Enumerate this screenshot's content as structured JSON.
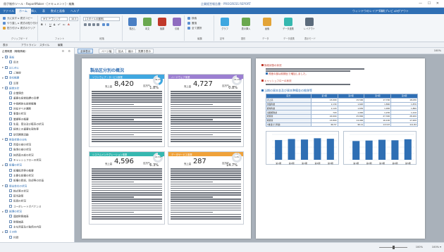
{
  "window": {
    "title": "冊子制作ツール - ReportMaker - [ドキュメント] - 編集",
    "center_title": "企業経営報告書 - PROGRESS REPORT",
    "controls": "— ☐ ✕"
  },
  "menu": {
    "tabs": [
      "ファイル",
      "ホーム",
      "挿入",
      "表",
      "数式と画像",
      "ヘルプ"
    ],
    "active_index": 1,
    "right": [
      "ウィンドウのレイアウト",
      "印刷プレビュー",
      "ログアウト"
    ]
  },
  "ribbon": {
    "clipboard": {
      "label": "クリップボード",
      "lines": [
        "元に戻す  ▸ 書式コピー",
        "やり直し  ▸ 書式の貼り付け",
        "貼り付け ▸ 書式のクリア"
      ]
    },
    "font": {
      "label": "フォント",
      "font_name": "ＭＳ Ｐゴシック",
      "font_size": "10.5",
      "styles": [
        "B",
        "I",
        "U",
        "S",
        "x²",
        "x₂",
        "A"
      ]
    },
    "paragraph": {
      "label": "段落",
      "style_value": "[スタイルの選択]"
    },
    "style_buttons": [
      {
        "label": "見出し"
      },
      {
        "label": "本文"
      },
      {
        "label": "強調"
      },
      {
        "label": "引用"
      }
    ],
    "edit": {
      "label": "編集",
      "lines": [
        "検索",
        "置換",
        "全て選択"
      ]
    },
    "insert_buttons": [
      {
        "label": "グラフ"
      },
      {
        "label": "表の挿入"
      },
      {
        "label": "画像"
      },
      {
        "label": "データ連携"
      },
      {
        "label": "レイアウト"
      }
    ],
    "group_labels": [
      "記号",
      "図形",
      "データ",
      "データ連携",
      "表示モード"
    ]
  },
  "subbar": {
    "tabs": [
      "表示",
      "アウトライン",
      "スタイル",
      "編集"
    ]
  },
  "sidebar": {
    "header": "企業概要（概略情報）",
    "icons": "☰ ⚙",
    "items": [
      {
        "label": "表紙",
        "group": true,
        "indent": 0
      },
      {
        "label": "目次",
        "group": false,
        "indent": 1
      },
      {
        "label": "はじめに",
        "group": true,
        "indent": 0
      },
      {
        "label": "ご挨拶",
        "group": false,
        "indent": 1
      },
      {
        "label": "会社概要",
        "group": true,
        "indent": 0
      },
      {
        "label": "沿革",
        "group": false,
        "indent": 1
      },
      {
        "label": "経営方針",
        "group": true,
        "indent": 0
      },
      {
        "label": "企業理念",
        "group": false,
        "indent": 1
      },
      {
        "label": "重要な経営指標の目標",
        "group": false,
        "indent": 1
      },
      {
        "label": "中長期的な経営戦略",
        "group": false,
        "indent": 1
      },
      {
        "label": "対処すべき課題",
        "group": false,
        "indent": 1
      },
      {
        "label": "事業の状況",
        "group": false,
        "indent": 1
      },
      {
        "label": "業績等の概要",
        "group": false,
        "indent": 1
      },
      {
        "label": "生産、受注及び販売の状況",
        "group": false,
        "indent": 1
      },
      {
        "label": "経営上の重要な契約等",
        "group": false,
        "indent": 1
      },
      {
        "label": "研究開発活動",
        "group": false,
        "indent": 1
      },
      {
        "label": "財政状態の分析",
        "group": true,
        "indent": 0
      },
      {
        "label": "資産の部の状況",
        "group": false,
        "indent": 1
      },
      {
        "label": "負債の部の状況",
        "group": false,
        "indent": 1
      },
      {
        "label": "純資産の部の状況",
        "group": false,
        "indent": 1
      },
      {
        "label": "キャッシュフローの状況",
        "group": false,
        "indent": 1
      },
      {
        "label": "設備の状況",
        "group": true,
        "indent": 0
      },
      {
        "label": "設備投資等の概要",
        "group": false,
        "indent": 1
      },
      {
        "label": "主要な設備の状況",
        "group": false,
        "indent": 1
      },
      {
        "label": "設備の新設、除却等の計画",
        "group": false,
        "indent": 1
      },
      {
        "label": "提出会社の状況",
        "group": true,
        "indent": 0
      },
      {
        "label": "株式等の状況",
        "group": false,
        "indent": 1
      },
      {
        "label": "配当政策",
        "group": false,
        "indent": 1
      },
      {
        "label": "役員の状況",
        "group": false,
        "indent": 1
      },
      {
        "label": "コーポレートガバナンス",
        "group": false,
        "indent": 1
      },
      {
        "label": "経理の状況",
        "group": true,
        "indent": 0
      },
      {
        "label": "連結財務諸表",
        "group": false,
        "indent": 1
      },
      {
        "label": "財務諸表",
        "group": false,
        "indent": 1
      },
      {
        "label": "主な資産及び負債の内容",
        "group": false,
        "indent": 1
      },
      {
        "label": "その他",
        "group": true,
        "indent": 0
      },
      {
        "label": "付録",
        "group": false,
        "indent": 1
      }
    ]
  },
  "toolbar": {
    "buttons": [
      "全体表示",
      "ページ幅",
      "拡大",
      "縮小",
      "見開き表示"
    ],
    "active_index": 0,
    "right": "100%"
  },
  "page_left": {
    "title": "製品区分別の概況",
    "cards": [
      {
        "band": "ソフトウェア・サービス事業",
        "color": "#3fa7e0",
        "pct": "46.2%",
        "label": "売上高",
        "value": "8,420",
        "unit": "百万円",
        "sub": "1.8%"
      },
      {
        "band": "ハードウェア事業",
        "color": "#9b7fd1",
        "pct": "23.1%",
        "label": "売上高",
        "value": "4,727",
        "unit": "百万円",
        "sub": "0.8%"
      },
      {
        "band": "システムインテグレーション事業",
        "color": "#36b8b0",
        "pct": "22.5%",
        "label": "売上高",
        "value": "4,596",
        "unit": "百万円",
        "sub": "6.3%"
      },
      {
        "band": "データサービス事業",
        "color": "#f0a23a",
        "pct": "1.4%",
        "label": "売上高",
        "value": "287",
        "unit": "百万円",
        "sub": "14.7%"
      }
    ],
    "card_pct_colors": [
      "#3fa7e0",
      "#9b7fd1",
      "#36b8b0",
      "#f0a23a"
    ]
  },
  "page_right": {
    "heads": [
      "財政状態の状況",
      "資産の部は前期比で増加しました。",
      "キャッシュフローの状況",
      "当期の資本金及び資本準備金の推移等"
    ],
    "table": {
      "headers": [
        "区分",
        "第1期",
        "第2期",
        "第3期",
        "第4期"
      ],
      "rows": [
        [
          "売上高",
          "13,000",
          "15,500",
          "17,700",
          "18,030"
        ],
        [
          "営業利益",
          "1,130",
          "1,620",
          "1,890",
          "1,870"
        ],
        [
          "経常利益",
          "1,120",
          "1,630",
          "1,900",
          "1,860"
        ],
        [
          "当期純利益",
          "720",
          "1,040",
          "1,230",
          "1,210"
        ],
        [
          "総資産",
          "24,600",
          "25,800",
          "27,300",
          "28,200"
        ],
        [
          "純資産",
          "13,800",
          "14,900",
          "16,100",
          "17,200"
        ],
        [
          "1株当たり利益",
          "66.57",
          "96.11",
          "113.67",
          "111.84"
        ]
      ]
    },
    "chart_data": [
      {
        "type": "bar",
        "categories": [
          "第1期",
          "第2期",
          "第3期",
          "第4期",
          "第5期"
        ],
        "values": [
          78,
          82,
          80,
          85,
          83
        ],
        "ylim": [
          0,
          100
        ],
        "color": "#2f6fb4",
        "grid": true,
        "title": "",
        "xlabel": "",
        "ylabel": ""
      },
      {
        "type": "bar",
        "categories": [
          "第1期",
          "第2期",
          "第3期",
          "第4期",
          "第5期"
        ],
        "values": [
          74,
          76,
          79,
          77,
          81
        ],
        "ylim": [
          0,
          100
        ],
        "color": "#2f6fb4",
        "grid": true,
        "title": "",
        "xlabel": "",
        "ylabel": ""
      }
    ]
  },
  "status": {
    "zoom": "100%",
    "zoom_level": 0.5,
    "right": "100% ▾"
  }
}
